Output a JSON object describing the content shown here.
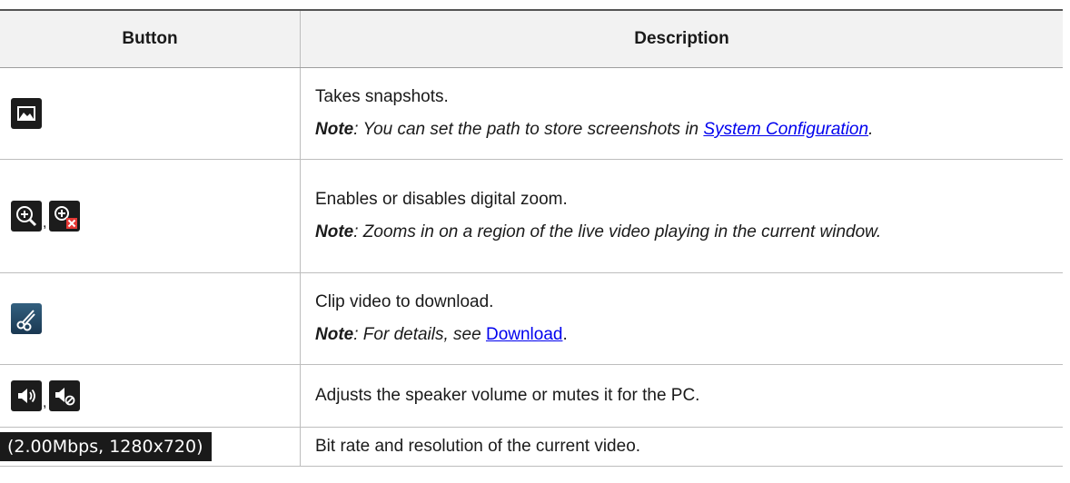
{
  "table": {
    "headers": {
      "button": "Button",
      "description": "Description"
    },
    "rows": [
      {
        "icons": [
          "snapshot-icon"
        ],
        "description": "Takes snapshots.",
        "note_label": "Note",
        "note_text": ": You can set the path to store screenshots in ",
        "note_link": "System Configuration",
        "note_tail": "."
      },
      {
        "icons": [
          "zoom-in-icon",
          "zoom-disable-icon"
        ],
        "separator": ",",
        "description": "Enables or disables digital zoom.",
        "note_label": "Note",
        "note_text": ": Zooms in on a region of the live video playing in the current window."
      },
      {
        "icons": [
          "clip-video-icon"
        ],
        "description": "Clip video to download.",
        "note_label": "Note",
        "note_text": ": For details, see ",
        "note_link": "Download",
        "note_tail": "."
      },
      {
        "icons": [
          "speaker-icon",
          "speaker-muted-icon"
        ],
        "separator": ",",
        "description": "Adjusts the speaker volume or mutes it for the PC."
      },
      {
        "button_text": "(2.00Mbps, 1280x720)",
        "description": "Bit rate and resolution of the current video."
      }
    ]
  },
  "colors": {
    "icon_bg": "#1c1c1c",
    "link": "#0000ee",
    "header_bg": "#f2f2f2",
    "mute_red": "#e53935"
  }
}
